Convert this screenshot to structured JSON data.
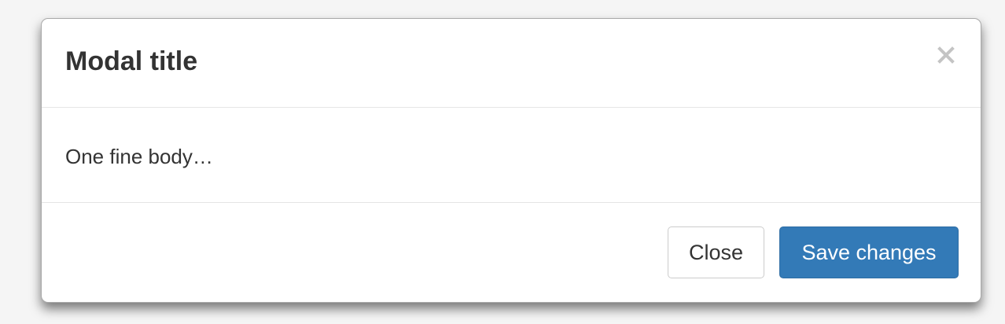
{
  "modal": {
    "title": "Modal title",
    "close_icon": "close-x-icon",
    "body_text": "One fine body…",
    "footer": {
      "close_label": "Close",
      "save_label": "Save changes"
    }
  },
  "colors": {
    "primary": "#337ab7",
    "page_background": "#f5f5f5",
    "text": "#333333"
  }
}
